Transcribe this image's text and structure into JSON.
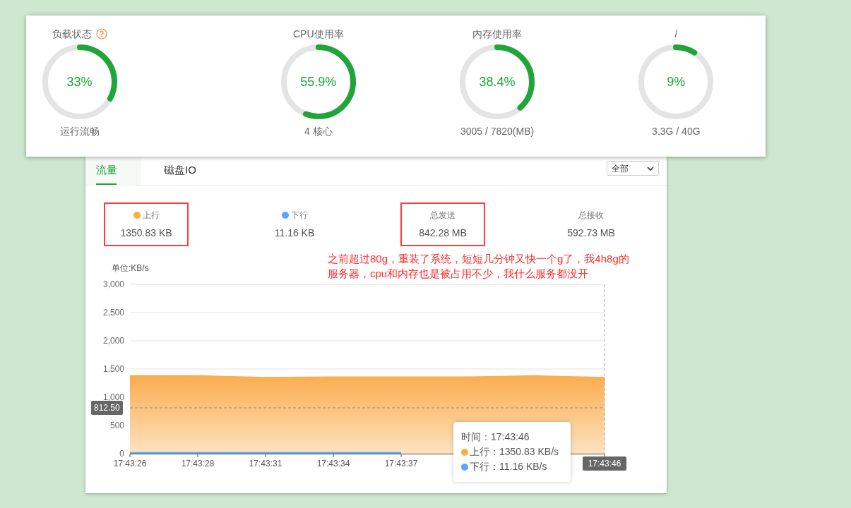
{
  "status_card": {
    "gauges": [
      {
        "title": "负载状态",
        "help": true,
        "value": "33%",
        "level": 0.33,
        "caption": "运行流畅"
      },
      {
        "title": "CPU使用率",
        "help": false,
        "value": "55.9%",
        "level": 0.559,
        "caption": "4 核心"
      },
      {
        "title": "内存使用率",
        "help": false,
        "value": "38.4%",
        "level": 0.384,
        "caption": "3005 / 7820(MB)"
      },
      {
        "title": "/",
        "help": false,
        "value": "9%",
        "level": 0.09,
        "caption": "3.3G / 40G"
      }
    ]
  },
  "traffic_panel": {
    "tabs": [
      {
        "label": "流量",
        "selected": true
      },
      {
        "label": "磁盘IO",
        "selected": false
      }
    ],
    "range_select": {
      "value": "全部"
    },
    "stats": [
      {
        "label": "上行",
        "color": "#f5b041",
        "value": "1350.83 KB",
        "highlighted": true
      },
      {
        "label": "下行",
        "color": "#52a9ff",
        "value": "11.16 KB",
        "highlighted": false
      },
      {
        "label": "总发送",
        "value": "842.28 MB",
        "highlighted": true
      },
      {
        "label": "总接收",
        "value": "592.73 MB",
        "highlighted": false
      }
    ],
    "note": "之前超过80g，重装了系统，短短几分钟又快一个g了，我4h8g的服务器，cpu和内存也是被占用不少，我什么服务都没开",
    "chart": {
      "unit": "单位:KB/s",
      "chart_data": {
        "type": "area",
        "grid": true,
        "ref_lines": [
          {
            "axis": "y",
            "value": 812.5,
            "label": "812.50"
          }
        ],
        "categories": [
          "17:43:26",
          "17:43:28",
          "17:43:31",
          "17:43:34",
          "17:43:37",
          null,
          null,
          "17:43:46"
        ],
        "ylim": [
          0,
          3000
        ],
        "yticks": [
          {
            "value": 0,
            "label": "0"
          },
          {
            "value": 500,
            "label": "500"
          },
          {
            "value": 1000,
            "label": "1,000"
          },
          {
            "value": 1500,
            "label": "1,500"
          },
          {
            "value": 2000,
            "label": "2,000"
          },
          {
            "value": 2500,
            "label": "2,500"
          },
          {
            "value": 3000,
            "label": "3,000"
          }
        ],
        "series": [
          {
            "name": "上行",
            "color": "#fbad4f",
            "values": [
              1380,
              1380,
              1350,
              1360,
              1360,
              1360,
              1380,
              1350
            ]
          },
          {
            "name": "下行",
            "color": "#52a9ff",
            "values": [
              10,
              10,
              10,
              10,
              10,
              null,
              null,
              null
            ]
          }
        ]
      },
      "tooltip": {
        "time": "时间：17:43:46",
        "rows": [
          {
            "color": "#f5b041",
            "value": "：1350.83 KB/s"
          },
          {
            "color": "#52a9ff",
            "value": "：11.16 KB/s"
          }
        ]
      }
    }
  }
}
